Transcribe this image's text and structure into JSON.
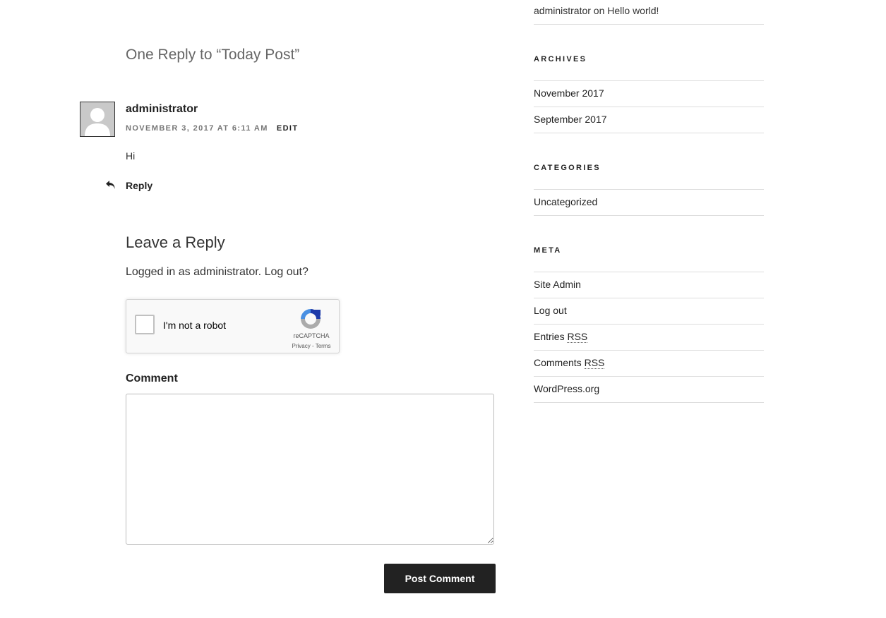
{
  "comments": {
    "title": "One Reply to “Today Post”",
    "items": [
      {
        "author": "administrator",
        "meta": "November 3, 2017 at 6:11 am",
        "edit_label": "Edit",
        "content": "Hi",
        "reply_label": "Reply"
      }
    ]
  },
  "reply_form": {
    "title": "Leave a Reply",
    "logged_in_prefix": "Logged in as ",
    "logged_in_user": "administrator",
    "logged_in_suffix": ". ",
    "logout_label": "Log out?",
    "recaptcha": {
      "label": "I'm not a robot",
      "brand": "reCAPTCHA",
      "privacy": "Privacy",
      "separator": " - ",
      "terms": "Terms"
    },
    "comment_label": "Comment",
    "comment_value": "",
    "submit_label": "Post Comment"
  },
  "sidebar": {
    "recent_comment": {
      "author": "administrator",
      "connector": " on ",
      "post": "Hello world!"
    },
    "archives": {
      "title": "Archives",
      "items": [
        "November 2017",
        "September 2017"
      ]
    },
    "categories": {
      "title": "Categories",
      "items": [
        "Uncategorized"
      ]
    },
    "meta": {
      "title": "Meta",
      "site_admin": "Site Admin",
      "log_out": "Log out",
      "entries_prefix": "Entries ",
      "comments_prefix": "Comments ",
      "rss": "RSS",
      "wordpress": "WordPress.org"
    }
  }
}
